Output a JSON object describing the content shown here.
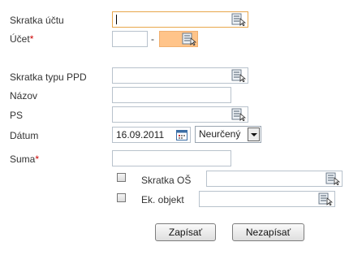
{
  "form": {
    "skratka_uctu": {
      "label": "Skratka účtu",
      "value": ""
    },
    "ucet": {
      "label": "Účet",
      "required_mark": "*",
      "separator": "-",
      "prefix_value": "",
      "number_value": ""
    },
    "skratka_typu_ppd": {
      "label": "Skratka typu PPD",
      "value": ""
    },
    "nazov": {
      "label": "Názov",
      "value": ""
    },
    "ps": {
      "label": "PS",
      "value": ""
    },
    "datum": {
      "label": "Dátum",
      "value": "16.09.2011",
      "type_selected": "Neurčený"
    },
    "suma": {
      "label": "Suma",
      "required_mark": "*",
      "value": ""
    },
    "skratka_os": {
      "label": "Skratka OŠ",
      "checked": false,
      "value": ""
    },
    "ek_objekt": {
      "label": "Ek. objekt",
      "checked": false,
      "value": ""
    }
  },
  "buttons": {
    "save": "Zapísať",
    "cancel": "Nezapísať"
  },
  "colors": {
    "focus_border": "#e8a74c",
    "highlight_fill": "#ffc48a",
    "required": "#cc0000"
  },
  "icons": {
    "picker": "lookup-list-icon",
    "calendar": "calendar-icon"
  }
}
